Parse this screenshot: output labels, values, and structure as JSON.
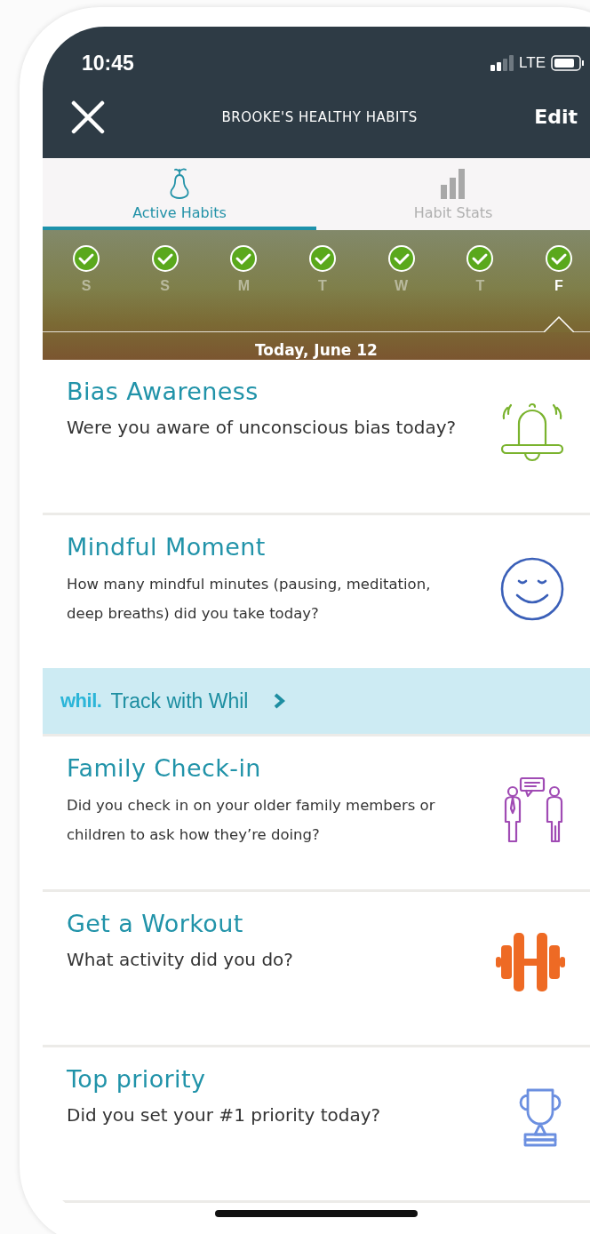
{
  "status_bar": {
    "time": "10:45",
    "network": "LTE"
  },
  "header": {
    "title": "BROOKE'S HEALTHY HABITS",
    "action": "Edit"
  },
  "tabs": [
    {
      "label": "Active Habits",
      "kind": "pear",
      "selected": true
    },
    {
      "label": "Habit Stats",
      "kind": "bars",
      "selected": false
    }
  ],
  "days": [
    {
      "label": "S",
      "done": true,
      "selected": false
    },
    {
      "label": "S",
      "done": true,
      "selected": false
    },
    {
      "label": "M",
      "done": true,
      "selected": false
    },
    {
      "label": "T",
      "done": true,
      "selected": false
    },
    {
      "label": "W",
      "done": true,
      "selected": false
    },
    {
      "label": "T",
      "done": true,
      "selected": false
    },
    {
      "label": "F",
      "done": true,
      "selected": true
    }
  ],
  "date_label": "Today, June 12",
  "habits": [
    {
      "title": "Bias Awareness",
      "question": "Were you aware of unconscious bias today?",
      "kind": "bell",
      "color": "#7ab32e",
      "large": true
    },
    {
      "title": "Mindful Moment",
      "question": "How many mindful minutes (pausing, meditation, deep breaths) did you take today?",
      "kind": "face",
      "color": "#3a5fb8",
      "large": false,
      "link": {
        "brand": "whil.",
        "label": "Track with Whil"
      }
    },
    {
      "title": "Family Check-in",
      "question": "Did you check in on your older family members or children to ask how they’re doing?",
      "kind": "people",
      "color": "#a04bb4",
      "large": false
    },
    {
      "title": "Get a Workout",
      "question": "What activity did you do?",
      "kind": "dumbbell",
      "color": "#ee6a24",
      "large": true
    },
    {
      "title": "Top priority",
      "question": "Did you set your #1 priority today?",
      "kind": "trophy",
      "color": "#6b8fe0",
      "large": true
    }
  ]
}
